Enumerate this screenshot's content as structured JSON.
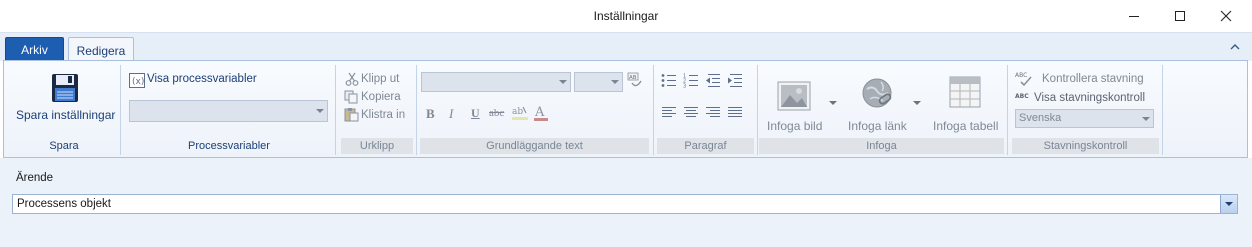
{
  "window": {
    "title": "Inställningar"
  },
  "tabs": {
    "file": "Arkiv",
    "edit": "Redigera"
  },
  "ribbon": {
    "save_group": {
      "button": "Spara inställningar",
      "label": "Spara"
    },
    "process_group": {
      "show_vars": "Visa processvariabler",
      "combo_value": "",
      "label": "Processvariabler"
    },
    "clipboard_group": {
      "cut": "Klipp ut",
      "copy": "Kopiera",
      "paste": "Klistra in",
      "label": "Urklipp"
    },
    "text_group": {
      "font_value": "",
      "size_value": "",
      "label": "Grundläggande text"
    },
    "paragraph_group": {
      "label": "Paragraf"
    },
    "insert_group": {
      "image": "Infoga bild",
      "link": "Infoga länk",
      "table": "Infoga tabell",
      "label": "Infoga"
    },
    "spell_group": {
      "check": "Kontrollera stavning",
      "show": "Visa stavningskontroll",
      "language": "Svenska",
      "label": "Stavningskontroll"
    }
  },
  "form": {
    "subject_label": "Ärende",
    "subject_value": "Processens objekt"
  },
  "colors": {
    "accent": "#1e5eb0",
    "ribbon_bg": "#eef3fa",
    "label_text": "#1c3f76",
    "disabled_text": "#7f8894"
  },
  "icons": [
    "minimize-icon",
    "maximize-icon",
    "close-icon",
    "collapse-ribbon-icon",
    "floppy-disk-icon",
    "variables-icon",
    "scissors-icon",
    "copy-icon",
    "paste-icon",
    "font-size-icon",
    "bold-icon",
    "italic-icon",
    "underline-icon",
    "strikethrough-icon",
    "highlight-icon",
    "font-color-icon",
    "bullet-list-icon",
    "numbered-list-icon",
    "outdent-icon",
    "indent-icon",
    "align-left-icon",
    "align-center-icon",
    "align-right-icon",
    "justify-icon",
    "insert-image-icon",
    "insert-link-icon",
    "insert-table-icon",
    "spellcheck-icon",
    "show-spellcheck-icon"
  ]
}
